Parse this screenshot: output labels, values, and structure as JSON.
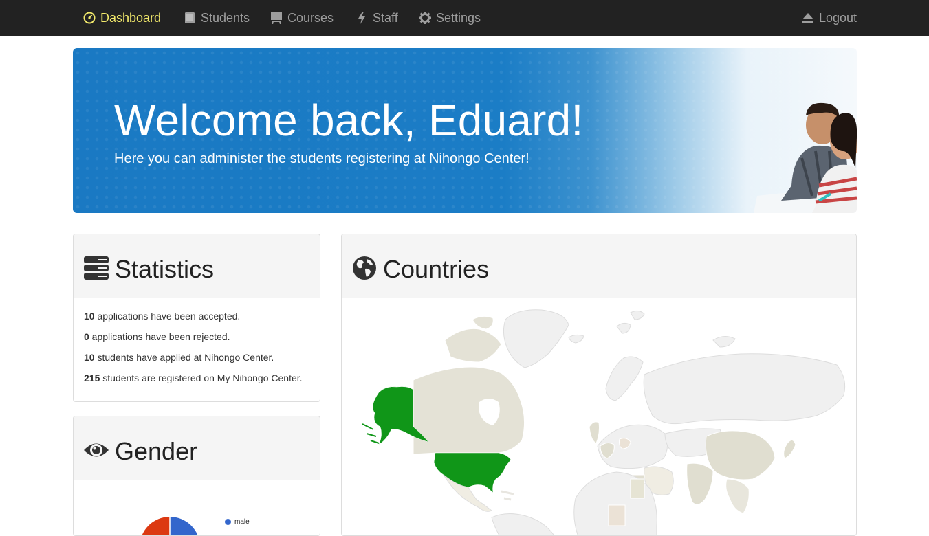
{
  "nav": {
    "items": [
      {
        "label": "Dashboard",
        "icon": "dashboard-icon",
        "active": true
      },
      {
        "label": "Students",
        "icon": "book-icon"
      },
      {
        "label": "Courses",
        "icon": "blackboard-icon"
      },
      {
        "label": "Staff",
        "icon": "flash-icon"
      },
      {
        "label": "Settings",
        "icon": "cog-icon"
      }
    ],
    "logout": "Logout",
    "active_color": "#f2e96b"
  },
  "hero": {
    "title": "Welcome back, Eduard!",
    "subtitle": "Here you can administer the students registering at Nihongo Center!"
  },
  "statistics": {
    "title": "Statistics",
    "lines": [
      {
        "count": "10",
        "text": " applications have been accepted."
      },
      {
        "count": "0",
        "text": " applications have been rejected."
      },
      {
        "count": "10",
        "text": " students have applied at Nihongo Center."
      },
      {
        "count": "215",
        "text": " students are registered on My Nihongo Center."
      }
    ]
  },
  "gender": {
    "title": "Gender",
    "legend": [
      {
        "label": "male",
        "color": "#3366cc"
      }
    ],
    "slice_colors": [
      "#3366cc",
      "#dc3912"
    ]
  },
  "countries": {
    "title": "Countries",
    "highlight_color": "#109618"
  }
}
